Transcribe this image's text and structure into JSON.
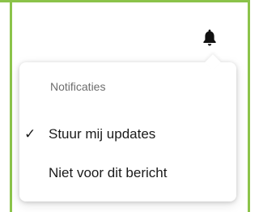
{
  "colors": {
    "frame_border": "#8bc34a",
    "bell": "#111111"
  },
  "header": {
    "bell_icon": "bell-icon"
  },
  "notifications_menu": {
    "title": "Notificaties",
    "items": [
      {
        "label": "Stuur mij updates",
        "checked": true,
        "check_glyph": "✓"
      },
      {
        "label": "Niet voor dit bericht",
        "checked": false,
        "check_glyph": ""
      }
    ]
  }
}
